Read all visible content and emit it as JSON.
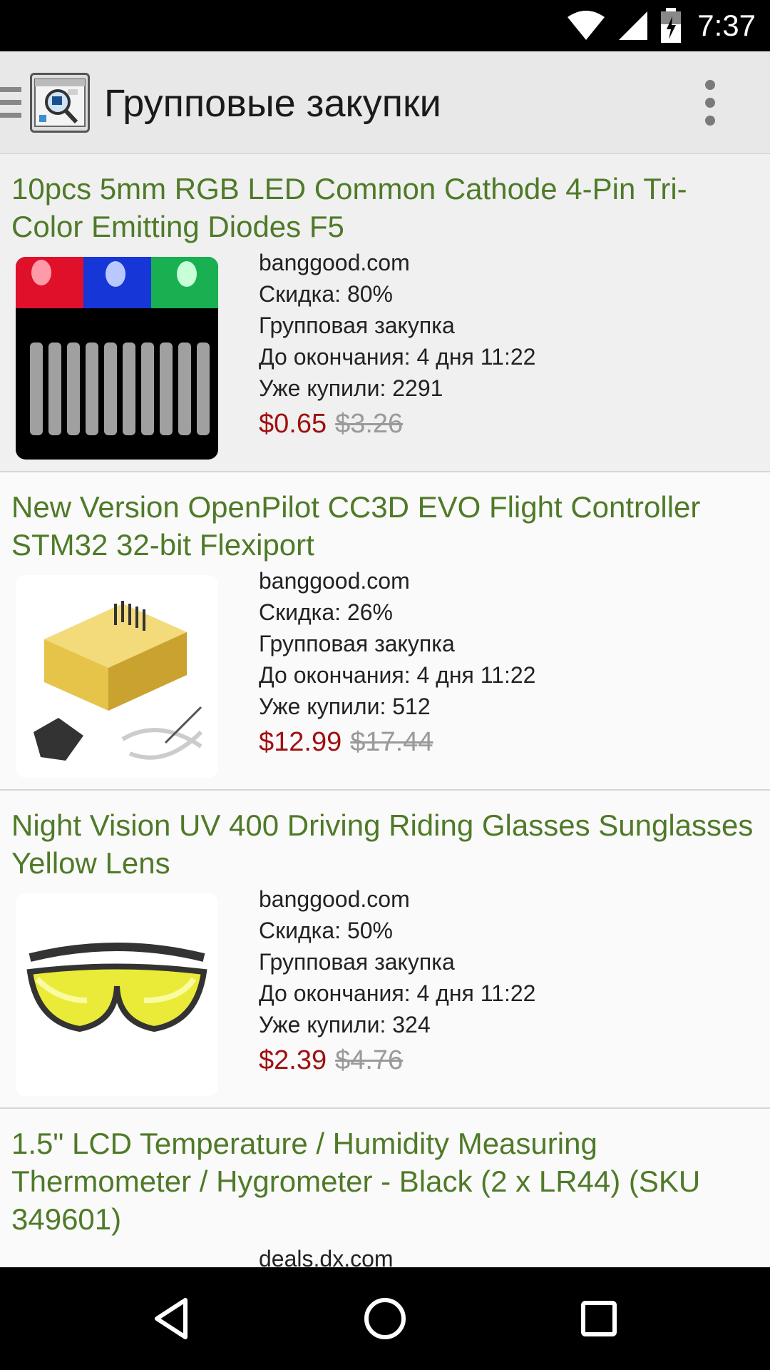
{
  "status_bar": {
    "time": "7:37",
    "icons": [
      "wifi-icon",
      "signal-icon",
      "battery-charging-icon"
    ]
  },
  "app_bar": {
    "title": "Групповые закупки",
    "icons": [
      "drawer-menu-icon",
      "app-logo",
      "overflow-menu-icon"
    ]
  },
  "deals": [
    {
      "title": "10pcs 5mm RGB LED Common Cathode 4-Pin Tri-Color Emitting Diodes F5",
      "store": "banggood.com",
      "discount": "Скидка: 80%",
      "type": "Групповая закупка",
      "ends": "До окончания: 4 дня 11:22",
      "bought": "Уже купили: 2291",
      "price": "$0.65",
      "old_price": "$3.26",
      "image": "rgb-led-image"
    },
    {
      "title": "New Version OpenPilot CC3D EVO Flight Controller STM32 32-bit Flexiport",
      "store": "banggood.com",
      "discount": "Скидка: 26%",
      "type": "Групповая закупка",
      "ends": "До окончания: 4 дня 11:22",
      "bought": "Уже купили: 512",
      "price": "$12.99",
      "old_price": "$17.44",
      "image": "flight-controller-image"
    },
    {
      "title": "Night Vision UV 400 Driving Riding Glasses Sunglasses Yellow Lens",
      "store": "banggood.com",
      "discount": "Скидка: 50%",
      "type": "Групповая закупка",
      "ends": "До окончания: 4 дня 11:22",
      "bought": "Уже купили: 324",
      "price": "$2.39",
      "old_price": "$4.76",
      "image": "yellow-glasses-image"
    },
    {
      "title": "1.5\" LCD Temperature / Humidity Measuring Thermometer / Hygrometer - Black (2 x LR44) (SKU 349601)",
      "store": "deals.dx.com"
    }
  ],
  "nav_bar": {
    "icons": [
      "back-icon",
      "home-icon",
      "recents-icon"
    ]
  },
  "colors": {
    "title_green": "#4f7a28",
    "price_red": "#a01010",
    "old_price_gray": "#9a9a9a"
  }
}
